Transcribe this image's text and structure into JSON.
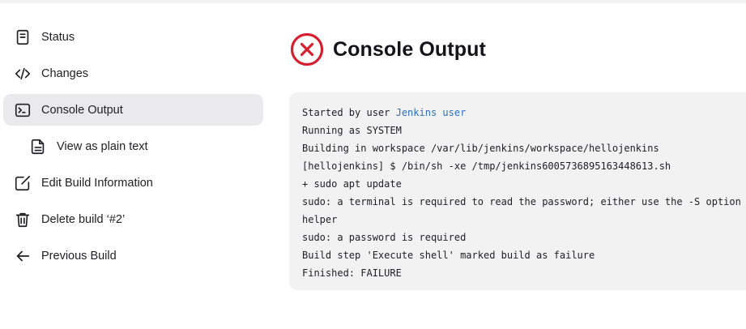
{
  "sidebar": {
    "items": [
      {
        "label": "Status",
        "icon": "document-icon"
      },
      {
        "label": "Changes",
        "icon": "code-icon"
      },
      {
        "label": "Console Output",
        "icon": "terminal-icon",
        "active": true
      },
      {
        "label": "View as plain text",
        "icon": "file-text-icon"
      },
      {
        "label": "Edit Build Information",
        "icon": "edit-icon"
      },
      {
        "label": "Delete build ‘#2’",
        "icon": "trash-icon"
      },
      {
        "label": "Previous Build",
        "icon": "arrow-left-icon"
      }
    ]
  },
  "main": {
    "title": "Console Output",
    "status": "failure",
    "status_icon": "x-circle-icon",
    "status_color": "#d4202f"
  },
  "console": {
    "started_prefix": "Started by user ",
    "started_user": "Jenkins user",
    "lines": [
      "Running as SYSTEM",
      "Building in workspace /var/lib/jenkins/workspace/hellojenkins",
      "[hellojenkins] $ /bin/sh -xe /tmp/jenkins6005736895163448613.sh",
      "+ sudo apt update",
      "sudo: a terminal is required to read the password; either use the -S option",
      "helper",
      "sudo: a password is required",
      "Build step 'Execute shell' marked build as failure",
      "Finished: FAILURE"
    ]
  },
  "colors": {
    "link": "#2c6fbd",
    "active_bg": "#e9e9ee",
    "console_bg": "#f2f2f3"
  }
}
